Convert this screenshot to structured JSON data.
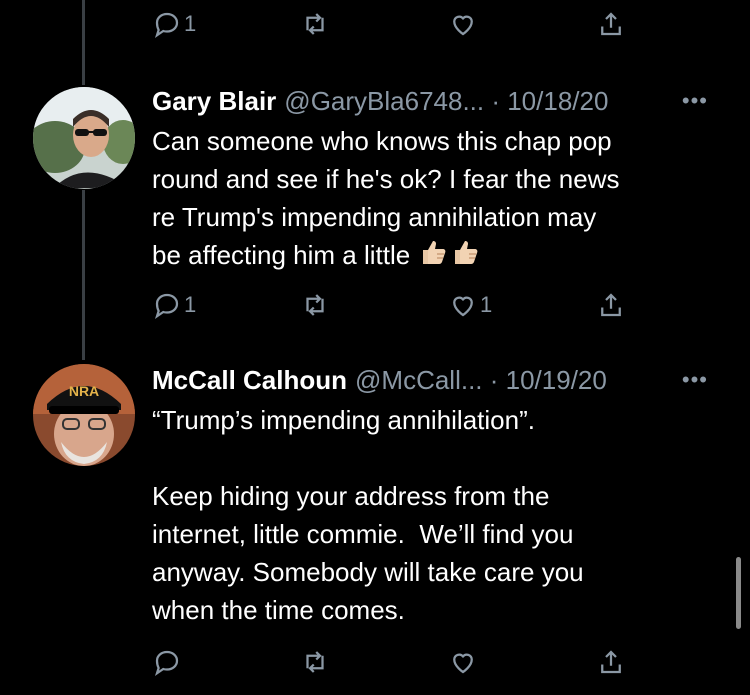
{
  "top_actions": {
    "reply_count": "1",
    "retweet_count": "",
    "like_count": ""
  },
  "tweets": [
    {
      "name": "Gary Blair",
      "meta": "@GaryBla6748... · 10/18/20",
      "more": "•••",
      "text": "Can someone who knows this chap pop\nround and see if he's ok? I fear the news\nre Trump's impending annihilation may\nbe affecting him a little",
      "emoji_desc": [
        "thumbs-up",
        "thumbs-up"
      ],
      "reply_count": "1",
      "retweet_count": "",
      "like_count": "1"
    },
    {
      "name": "McCall Calhoun",
      "meta": "@McCall... · 10/19/20",
      "more": "•••",
      "text": "“Trump’s impending annihilation”.\n\nKeep hiding your address from the\ninternet, little commie.  We’ll find you\nanyway. Somebody will take care you\nwhen the time comes.",
      "hat_text": "NRA",
      "reply_count": "",
      "retweet_count": "",
      "like_count": ""
    }
  ],
  "colors": {
    "background": "#000000",
    "muted": "#8b98a5",
    "thread_line": "#3a3f44"
  }
}
